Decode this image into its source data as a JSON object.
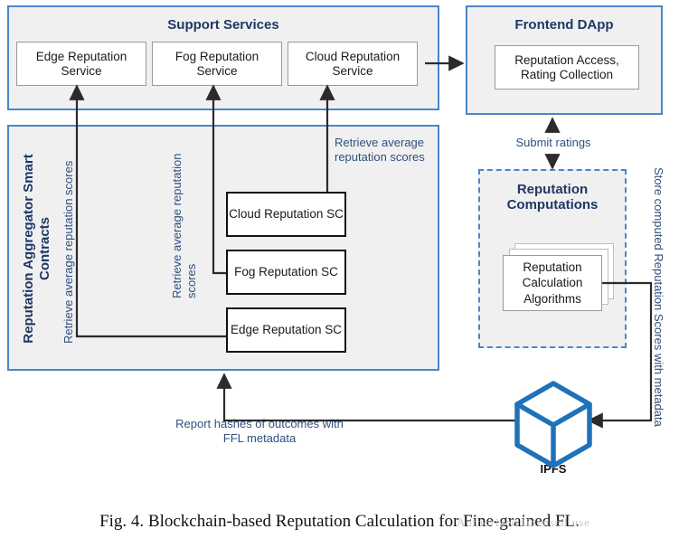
{
  "figure": {
    "caption": "Fig. 4.   Blockchain-based Reputation Calculation for Fine-grained FL.",
    "watermark": "Authorized licensed use"
  },
  "support_services": {
    "title": "Support Services",
    "boxes": [
      {
        "label": "Edge Reputation Service"
      },
      {
        "label": "Fog Reputation Service"
      },
      {
        "label": "Cloud Reputation Service"
      }
    ]
  },
  "frontend_dapp": {
    "title": "Frontend DApp",
    "box_label": "Reputation Access, Rating Collection"
  },
  "aggregator": {
    "title": "Reputation Aggregator Smart Contracts",
    "contracts": [
      {
        "label": "Cloud Reputation SC"
      },
      {
        "label": "Fog Reputation SC"
      },
      {
        "label": "Edge Reputation SC"
      }
    ],
    "annotations": {
      "edge_retrieve": "Retrieve average reputation scores",
      "fog_retrieve": "Retrieve average reputation scores",
      "cloud_retrieve": "Retrieve average reputation scores"
    }
  },
  "reputation_computations": {
    "title": "Reputation Computations",
    "card_label": "Reputation Calculation Algorithms"
  },
  "storage": {
    "label": "IPFS"
  },
  "edges": {
    "submit_ratings": "Submit ratings",
    "store_scores": "Store computed Reputation Scores with metadata",
    "report_hashes": "Report hashes of outcomes with FFL metadata"
  },
  "colors": {
    "panel_border": "#4a86c8",
    "panel_fill": "#f0f0f0",
    "title_text": "#1f3864",
    "annotation_text": "#2f4f7f",
    "line": "#2b2b2b",
    "ipfs_blue": "#1f72b8"
  }
}
